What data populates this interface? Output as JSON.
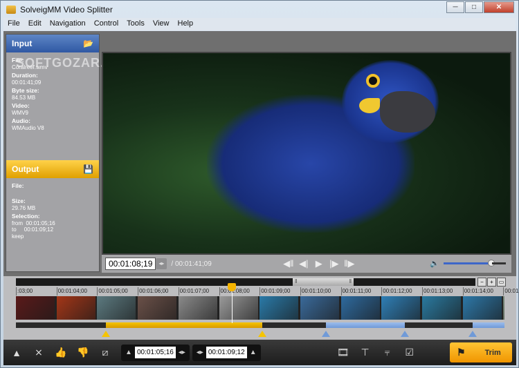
{
  "window": {
    "title": "SolveigMM Video Splitter",
    "minimize": "─",
    "maximize": "□",
    "close": "✕"
  },
  "menu": [
    "File",
    "Edit",
    "Navigation",
    "Control",
    "Tools",
    "View",
    "Help"
  ],
  "watermark": "SOFTGOZAR.COM",
  "input": {
    "header": "Input",
    "file_label": "File:",
    "file": "Coralreef.wmv",
    "duration_label": "Duration:",
    "duration": "00:01:41;09",
    "size_label": "Byte size:",
    "size": "84.53 MB",
    "video_label": "Video:",
    "video": "WMV9",
    "audio_label": "Audio:",
    "audio": "WMAudio V8"
  },
  "output": {
    "header": "Output",
    "file_label": "File:",
    "size_label": "Size:",
    "size": "29.76 MB",
    "selection_label": "Selection:",
    "from_label": "from",
    "from": "00:01:05;16",
    "to_label": "to",
    "to": "00:01:09;12",
    "mode": "keep"
  },
  "player": {
    "current_time": "00:01:08;19",
    "total_time": "/ 00:01:41;09",
    "volume": 0.8
  },
  "timeline": {
    "ticks": [
      ":03;00",
      "00:01:04;00",
      "00:01:05;00",
      "00:01:06;00",
      "00:01:07;00",
      "00:01:08;00",
      "00:01:09;00",
      "00:01:10;00",
      "00:01:11;00",
      "00:01:12;00",
      "00:01:13;00",
      "00:01:14;00",
      "00:01:1"
    ],
    "frame_colors": [
      "#5a1a1a",
      "#a33618",
      "#5c7a80",
      "#6a5048",
      "#8a8a8a",
      "#9a9a9a",
      "#2a7aa8",
      "#3a6a9a",
      "#2e6a9e",
      "#2f7fb6",
      "#2a7aa0",
      "#2d78a8",
      "#7a8a7a"
    ],
    "selection_color": "#f5c400",
    "segment_color": "#6f9ad8"
  },
  "bottom": {
    "start_time": "00:01:05;16",
    "end_time": "00:01:09;12",
    "trim_label": "Trim"
  }
}
